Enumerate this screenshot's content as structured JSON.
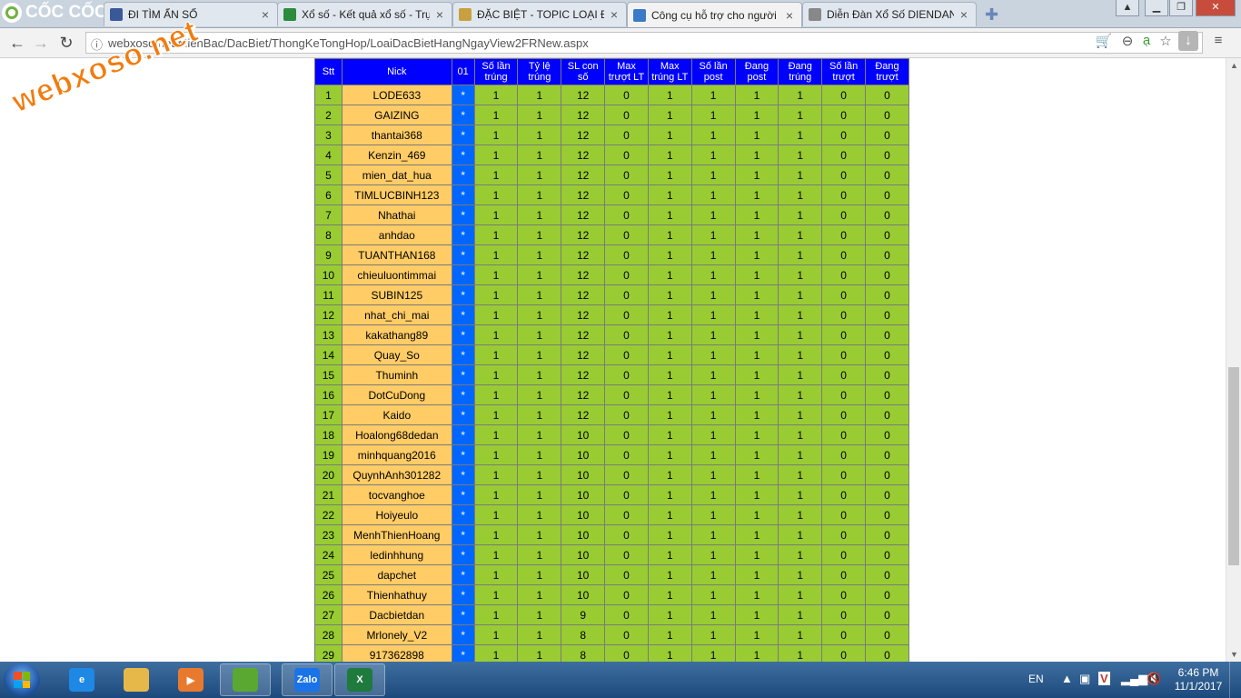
{
  "browser": {
    "brand": "CỐC CỐC",
    "tabs": [
      {
        "title": "ĐI TÌM ẨN SỐ",
        "icon": "facebook-icon",
        "color": "#3b5998"
      },
      {
        "title": "Xổ số - Kết quả xổ số - Trự",
        "icon": "chrome-style-icon",
        "color": "#2a8c3c"
      },
      {
        "title": "ĐẶC BIỆT - TOPIC LOẠI ĐẶ",
        "icon": "xs-icon",
        "color": "#c8a040"
      },
      {
        "title": "Công cụ hỗ trợ cho người",
        "icon": "tool-icon",
        "color": "#3a7ac8"
      },
      {
        "title": "Diễn Đàn Xổ Số DIENDAN",
        "icon": "page-icon",
        "color": "#888888"
      }
    ],
    "active_tab": 3,
    "url": "webxoso.net/MienBac/DacBiet/ThongKeTongHop/LoaiDacBietHangNgayView2FRNew.aspx"
  },
  "watermark": "webxoso.net",
  "table": {
    "headers": [
      "Stt",
      "Nick",
      "01",
      "Số lần trúng",
      "Tỷ lệ trúng",
      "SL con số",
      "Max trượt LT",
      "Max trúng LT",
      "Số lần post",
      "Đang post",
      "Đang trúng",
      "Số lần trượt",
      "Đang trượt"
    ],
    "rows": [
      [
        "1",
        "LODE633",
        "*",
        "1",
        "1",
        "12",
        "0",
        "1",
        "1",
        "1",
        "1",
        "0",
        "0"
      ],
      [
        "2",
        "GAIZING",
        "*",
        "1",
        "1",
        "12",
        "0",
        "1",
        "1",
        "1",
        "1",
        "0",
        "0"
      ],
      [
        "3",
        "thantai368",
        "*",
        "1",
        "1",
        "12",
        "0",
        "1",
        "1",
        "1",
        "1",
        "0",
        "0"
      ],
      [
        "4",
        "Kenzin_469",
        "*",
        "1",
        "1",
        "12",
        "0",
        "1",
        "1",
        "1",
        "1",
        "0",
        "0"
      ],
      [
        "5",
        "mien_dat_hua",
        "*",
        "1",
        "1",
        "12",
        "0",
        "1",
        "1",
        "1",
        "1",
        "0",
        "0"
      ],
      [
        "6",
        "TIMLUCBINH123",
        "*",
        "1",
        "1",
        "12",
        "0",
        "1",
        "1",
        "1",
        "1",
        "0",
        "0"
      ],
      [
        "7",
        "Nhathai",
        "*",
        "1",
        "1",
        "12",
        "0",
        "1",
        "1",
        "1",
        "1",
        "0",
        "0"
      ],
      [
        "8",
        "anhdao",
        "*",
        "1",
        "1",
        "12",
        "0",
        "1",
        "1",
        "1",
        "1",
        "0",
        "0"
      ],
      [
        "9",
        "TUANTHAN168",
        "*",
        "1",
        "1",
        "12",
        "0",
        "1",
        "1",
        "1",
        "1",
        "0",
        "0"
      ],
      [
        "10",
        "chieuluontimmai",
        "*",
        "1",
        "1",
        "12",
        "0",
        "1",
        "1",
        "1",
        "1",
        "0",
        "0"
      ],
      [
        "11",
        "SUBIN125",
        "*",
        "1",
        "1",
        "12",
        "0",
        "1",
        "1",
        "1",
        "1",
        "0",
        "0"
      ],
      [
        "12",
        "nhat_chi_mai",
        "*",
        "1",
        "1",
        "12",
        "0",
        "1",
        "1",
        "1",
        "1",
        "0",
        "0"
      ],
      [
        "13",
        "kakathang89",
        "*",
        "1",
        "1",
        "12",
        "0",
        "1",
        "1",
        "1",
        "1",
        "0",
        "0"
      ],
      [
        "14",
        "Quay_So",
        "*",
        "1",
        "1",
        "12",
        "0",
        "1",
        "1",
        "1",
        "1",
        "0",
        "0"
      ],
      [
        "15",
        "Thuminh",
        "*",
        "1",
        "1",
        "12",
        "0",
        "1",
        "1",
        "1",
        "1",
        "0",
        "0"
      ],
      [
        "16",
        "DotCuDong",
        "*",
        "1",
        "1",
        "12",
        "0",
        "1",
        "1",
        "1",
        "1",
        "0",
        "0"
      ],
      [
        "17",
        "Kaido",
        "*",
        "1",
        "1",
        "12",
        "0",
        "1",
        "1",
        "1",
        "1",
        "0",
        "0"
      ],
      [
        "18",
        "Hoalong68dedan",
        "*",
        "1",
        "1",
        "10",
        "0",
        "1",
        "1",
        "1",
        "1",
        "0",
        "0"
      ],
      [
        "19",
        "minhquang2016",
        "*",
        "1",
        "1",
        "10",
        "0",
        "1",
        "1",
        "1",
        "1",
        "0",
        "0"
      ],
      [
        "20",
        "QuynhAnh301282",
        "*",
        "1",
        "1",
        "10",
        "0",
        "1",
        "1",
        "1",
        "1",
        "0",
        "0"
      ],
      [
        "21",
        "tocvanghoe",
        "*",
        "1",
        "1",
        "10",
        "0",
        "1",
        "1",
        "1",
        "1",
        "0",
        "0"
      ],
      [
        "22",
        "Hoiyeulo",
        "*",
        "1",
        "1",
        "10",
        "0",
        "1",
        "1",
        "1",
        "1",
        "0",
        "0"
      ],
      [
        "23",
        "MenhThienHoang",
        "*",
        "1",
        "1",
        "10",
        "0",
        "1",
        "1",
        "1",
        "1",
        "0",
        "0"
      ],
      [
        "24",
        "ledinhhung",
        "*",
        "1",
        "1",
        "10",
        "0",
        "1",
        "1",
        "1",
        "1",
        "0",
        "0"
      ],
      [
        "25",
        "dapchet",
        "*",
        "1",
        "1",
        "10",
        "0",
        "1",
        "1",
        "1",
        "1",
        "0",
        "0"
      ],
      [
        "26",
        "Thienhathuy",
        "*",
        "1",
        "1",
        "10",
        "0",
        "1",
        "1",
        "1",
        "1",
        "0",
        "0"
      ],
      [
        "27",
        "Dacbietdan",
        "*",
        "1",
        "1",
        "9",
        "0",
        "1",
        "1",
        "1",
        "1",
        "0",
        "0"
      ],
      [
        "28",
        "Mrlonely_V2",
        "*",
        "1",
        "1",
        "8",
        "0",
        "1",
        "1",
        "1",
        "1",
        "0",
        "0"
      ],
      [
        "29",
        "917362898",
        "*",
        "1",
        "1",
        "8",
        "0",
        "1",
        "1",
        "1",
        "1",
        "0",
        "0"
      ]
    ]
  },
  "colors": {
    "header_bg": "#0000ff",
    "cell_bg": "#99cc33",
    "nick_bg": "#ffcc66",
    "star_bg": "#0066ff"
  },
  "taskbar": {
    "apps": [
      {
        "name": "internet-explorer",
        "label": "e",
        "color": "#1e88e5"
      },
      {
        "name": "file-explorer",
        "label": "",
        "color": "#e6b84a"
      },
      {
        "name": "media-player",
        "label": "▶",
        "color": "#e87a2e"
      },
      {
        "name": "coccoc-browser",
        "label": "",
        "color": "#5aa832"
      },
      {
        "name": "zalo",
        "label": "Zalo",
        "color": "#1a73e8"
      },
      {
        "name": "excel",
        "label": "X",
        "color": "#1f7a3e"
      }
    ],
    "lang": "EN",
    "time": "6:46 PM",
    "date": "11/1/2017"
  }
}
